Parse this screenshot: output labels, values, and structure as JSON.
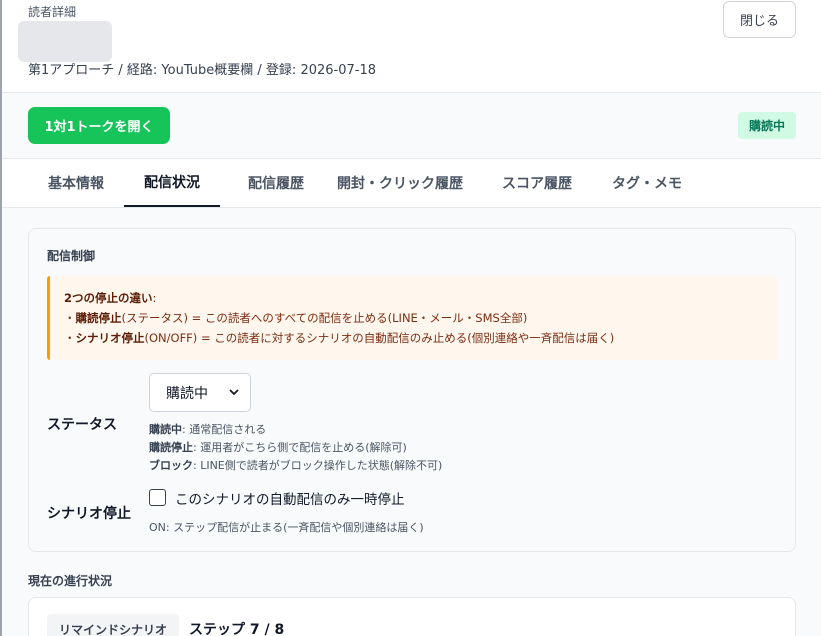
{
  "header": {
    "kicker": "読者詳細",
    "meta": "第1アプローチ / 経路: YouTube概要欄 / 登録: 2026-07-18",
    "close_label": "閉じる"
  },
  "action_bar": {
    "talk_button": "1対1トークを開く",
    "status_badge": "購読中",
    "badge_bg": "#d1fae5",
    "badge_color": "#047857",
    "talk_color": "#16c45a"
  },
  "tabs": [
    {
      "label": "基本情報",
      "active": false
    },
    {
      "label": "配信状況",
      "active": true
    },
    {
      "label": "配信履歴",
      "active": false
    },
    {
      "label": "開封・クリック履歴",
      "active": false
    },
    {
      "label": "スコア履歴",
      "active": false
    },
    {
      "label": "タグ・メモ",
      "active": false
    }
  ],
  "delivery_control": {
    "title": "配信制御",
    "callout": {
      "line1_bold": "2つの停止の違い",
      "line1_rest": ":",
      "line2_prefix": "・",
      "line2_bold": "購読停止",
      "line2_rest": "(ステータス) = この読者へのすべての配信を止める(LINE・メール・SMS全部)",
      "line3_prefix": "・",
      "line3_bold": "シナリオ停止",
      "line3_rest": "(ON/OFF) = この読者に対するシナリオの自動配信のみ止める(個別連絡や一斉配信は届く)"
    },
    "status": {
      "label": "ステータス",
      "selected": "購読中",
      "help": [
        {
          "term": "購読中",
          "desc": ": 通常配信される"
        },
        {
          "term": "購読停止",
          "desc": ": 運用者がこちら側で配信を止める(解除可)"
        },
        {
          "term": "ブロック",
          "desc": ": LINE側で読者がブロック操作した状態(解除不可)"
        }
      ]
    },
    "scenario_stop": {
      "label": "シナリオ停止",
      "checkbox_label": "このシナリオの自動配信のみ一時停止",
      "checked": false,
      "help": "ON: ステップ配信が止まる(一斉配信や個別連絡は届く)"
    }
  },
  "progress": {
    "title": "現在の進行状況",
    "scenario_name": "リマインドシナリオ",
    "step": "ステップ 7 / 8"
  }
}
